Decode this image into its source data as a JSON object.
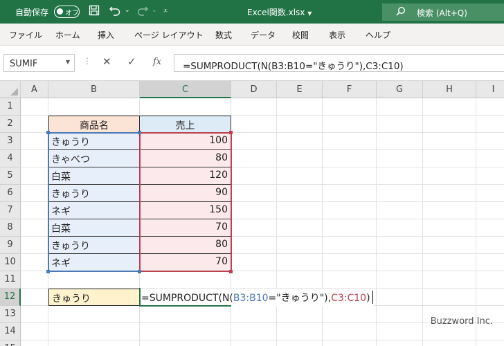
{
  "titlebar": {
    "autosave_label": "自動保存",
    "autosave_state": "オフ",
    "filename": "Excel関数.xlsx",
    "search_text": "検索 (Alt+Q)"
  },
  "menu": [
    "ファイル",
    "ホーム",
    "挿入",
    "ページ レイアウト",
    "数式",
    "データ",
    "校閲",
    "表示",
    "ヘルプ"
  ],
  "formula_bar": {
    "name_box": "SUMIF",
    "formula": "=SUMPRODUCT(N(B3:B10=\"きゅうり\"),C3:C10)"
  },
  "columns": [
    "A",
    "B",
    "C",
    "D",
    "E",
    "F",
    "G",
    "H",
    "I"
  ],
  "rows": [
    "1",
    "2",
    "3",
    "4",
    "5",
    "6",
    "7",
    "8",
    "9",
    "10",
    "11",
    "12",
    "13",
    "14",
    "15"
  ],
  "table": {
    "header": [
      "商品名",
      "売上"
    ],
    "rows": [
      {
        "name": "きゅうり",
        "sales": "100"
      },
      {
        "name": "きゃべつ",
        "sales": "80"
      },
      {
        "name": "白菜",
        "sales": "120"
      },
      {
        "name": "きゅうり",
        "sales": "90"
      },
      {
        "name": "ネギ",
        "sales": "150"
      },
      {
        "name": "白菜",
        "sales": "70"
      },
      {
        "name": "きゅうり",
        "sales": "80"
      },
      {
        "name": "ネギ",
        "sales": "70"
      }
    ]
  },
  "criteria_cell": "きゅうり",
  "edit_cell": {
    "part1": "=SUMPRODUCT(N(",
    "range1": "B3:B10",
    "part2": "=\"きゅうり\"),",
    "range2": "C3:C10",
    "part3": ")"
  },
  "watermark": "Buzzword Inc.",
  "colors": {
    "title_bar": "#217346",
    "range_blue": "#4b79b6",
    "range_red": "#b8424f",
    "header_b": "#fbe3d6",
    "header_c": "#ddebf7",
    "criteria": "#fff2cc"
  }
}
